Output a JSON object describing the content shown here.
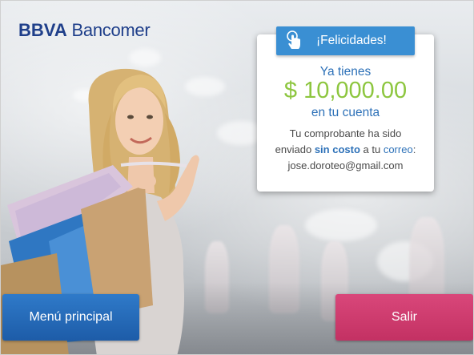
{
  "brand": {
    "bold": "BBVA",
    "regular": " Bancomer"
  },
  "card": {
    "header": "¡Felicidades!",
    "header_icon": "touch-hand-icon",
    "line1": "Ya tienes",
    "amount": "$ 10,000.00",
    "line3": "en tu cuenta",
    "msg_part1": "Tu comprobante ha sido",
    "msg_part2": "enviado ",
    "msg_highlight1": "sin costo",
    "msg_part3": " a tu ",
    "msg_highlight2": "correo",
    "msg_part4": ":",
    "email": "jose.doroteo@gmail.com"
  },
  "buttons": {
    "menu": "Menú principal",
    "exit": "Salir"
  },
  "colors": {
    "brand_blue": "#1f3f8a",
    "accent_blue": "#3a8fd3",
    "amount_green": "#8dc63f",
    "exit_pink": "#c33163"
  }
}
